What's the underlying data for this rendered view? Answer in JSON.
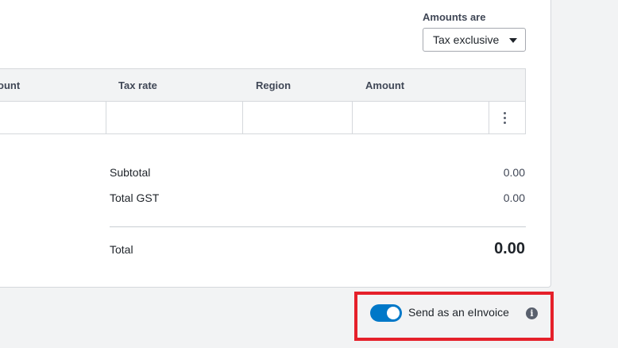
{
  "amounts": {
    "label": "Amounts are",
    "selected": "Tax exclusive"
  },
  "table": {
    "columns": [
      "ount",
      "Tax rate",
      "Region",
      "Amount"
    ]
  },
  "summary": {
    "subtotal_label": "Subtotal",
    "subtotal_value": "0.00",
    "gst_label": "Total GST",
    "gst_value": "0.00",
    "total_label": "Total",
    "total_value": "0.00"
  },
  "einvoice": {
    "label": "Send as an eInvoice",
    "enabled": true
  },
  "icons": {
    "menu": "kebab-menu-icon",
    "info": "info-icon",
    "dropdown": "chevron-down-icon"
  },
  "colors": {
    "toggle_on": "#0078c8",
    "highlight": "#e5202a"
  }
}
